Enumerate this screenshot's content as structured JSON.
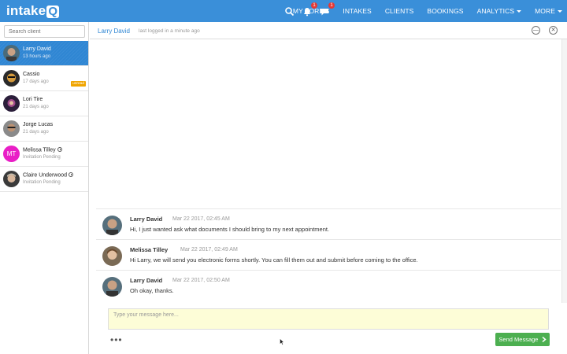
{
  "app": {
    "logo_text": "intake",
    "logo_q": "Q"
  },
  "nav": {
    "notifications_count": "1",
    "messages_count": "1",
    "links": [
      "MY FORMS",
      "INTAKES",
      "CLIENTS",
      "BOOKINGS",
      "ANALYTICS",
      "MORE"
    ]
  },
  "sidebar": {
    "search_placeholder": "Search client",
    "clients": [
      {
        "name": "Larry David",
        "sub": "13 hours ago",
        "active": true
      },
      {
        "name": "Cassio",
        "sub": "17 days ago",
        "badge": "unread"
      },
      {
        "name": "Lori Tire",
        "sub": "21 days ago"
      },
      {
        "name": "Jorge Lucas",
        "sub": "21 days ago"
      },
      {
        "name": "Melissa Tilley",
        "sub": "Invitation Pending",
        "initials": "MT"
      },
      {
        "name": "Claire Underwood",
        "sub": "Invitation Pending"
      }
    ]
  },
  "chat": {
    "header_name": "Larry David",
    "header_status": "last logged in a minute ago",
    "minimize_label": "—",
    "close_label": "✕",
    "messages": [
      {
        "author": "Larry David",
        "time": "Mar 22 2017, 02:45 AM",
        "text": "Hi, I just wanted ask what documents I should bring to my next appointment."
      },
      {
        "author": "Melissa Tilley",
        "time": "Mar 22 2017, 02:49 AM",
        "text": "Hi Larry, we will send you electronic forms shortly. You can fill them out and submit before coming to the office."
      },
      {
        "author": "Larry David",
        "time": "Mar 22 2017, 02:50 AM",
        "text": "Oh okay, thanks."
      }
    ],
    "composer_placeholder": "Type your message here...",
    "more_label": "•••",
    "send_label": "Send Message"
  },
  "colors": {
    "brand": "#3a8fd9",
    "send": "#4caf50",
    "unread": "#f0a500",
    "initials_bg": "#e91ec6"
  }
}
